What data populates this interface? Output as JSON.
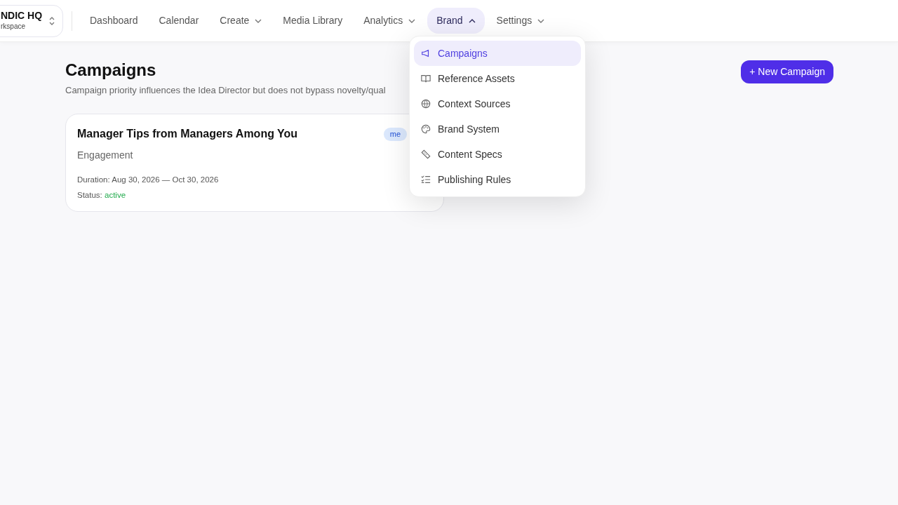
{
  "workspace": {
    "name": "NDIC HQ",
    "subtitle": "rkspace"
  },
  "nav": [
    {
      "label": "Dashboard",
      "kind": "link",
      "selected": false
    },
    {
      "label": "Calendar",
      "kind": "link",
      "selected": false
    },
    {
      "label": "Create",
      "kind": "dropdown",
      "expanded": false,
      "selected": false
    },
    {
      "label": "Media Library",
      "kind": "link",
      "selected": false
    },
    {
      "label": "Analytics",
      "kind": "dropdown",
      "expanded": false,
      "selected": false
    },
    {
      "label": "Brand",
      "kind": "dropdown",
      "expanded": true,
      "selected": true
    },
    {
      "label": "Settings",
      "kind": "dropdown",
      "expanded": false,
      "selected": false
    }
  ],
  "brand_menu": [
    {
      "label": "Campaigns",
      "selected": true
    },
    {
      "label": "Reference Assets",
      "selected": false
    },
    {
      "label": "Context Sources",
      "selected": false
    },
    {
      "label": "Brand System",
      "selected": false
    },
    {
      "label": "Content Specs",
      "selected": false
    },
    {
      "label": "Publishing Rules",
      "selected": false
    }
  ],
  "page": {
    "title": "Campaigns",
    "description": "Campaign priority influences the Idea Director but does not bypass novelty/qual",
    "new_button": "+ New Campaign"
  },
  "campaigns": [
    {
      "title": "Manager Tips from Managers Among You",
      "badge": "me",
      "category": "Engagement",
      "duration": "Duration: Aug 30, 2026 — Oct 30, 2026",
      "status_label": "Status:",
      "status": "active"
    }
  ]
}
